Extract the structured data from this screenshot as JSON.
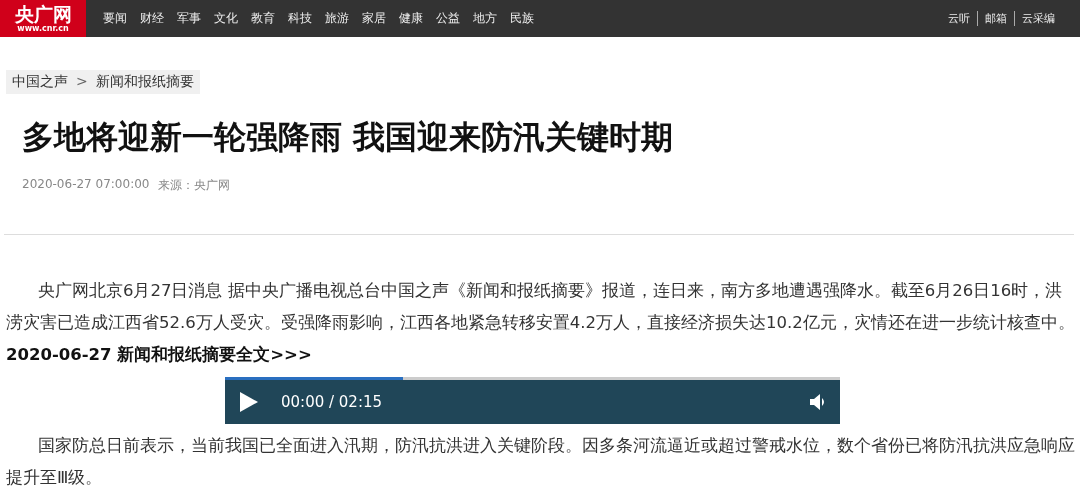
{
  "header": {
    "logo": {
      "name": "央广网",
      "domain": "www.cnr.cn"
    },
    "nav": [
      "要闻",
      "财经",
      "军事",
      "文化",
      "教育",
      "科技",
      "旅游",
      "家居",
      "健康",
      "公益",
      "地方",
      "民族"
    ],
    "links": [
      "云听",
      "邮箱",
      "云采编"
    ]
  },
  "breadcrumb": [
    "中国之声",
    ">",
    "新闻和报纸摘要"
  ],
  "article": {
    "title": "多地将迎新一轮强降雨 我国迎来防汛关键时期",
    "date": "2020-06-27 07:00:00",
    "source": "来源：央广网",
    "paragraphs": [
      {
        "text": "央广网北京6月27日消息 据中央广播电视总台中国之声《新闻和报纸摘要》报道，连日来，南方多地遭遇强降水。截至6月26日16时，洪涝灾害已造成江西省52.6万人受灾。受强降雨影响，江西各地紧急转移安置4.2万人，直接经济损失达10.2亿元，灾情还在进一步统计核查中。",
        "link": "2020-06-27 新闻和报纸摘要全文>>>"
      }
    ],
    "player": {
      "time": "00:00 / 02:15",
      "level": 0.29
    },
    "paragraphs_after": [
      {
        "text": "国家防总日前表示，当前我国已全面进入汛期，防汛抗洪进入关键阶段。因多条河流逼近或超过警戒水位，数个省份已将防汛抗洪应急响应提升至Ⅲ级。"
      }
    ]
  }
}
